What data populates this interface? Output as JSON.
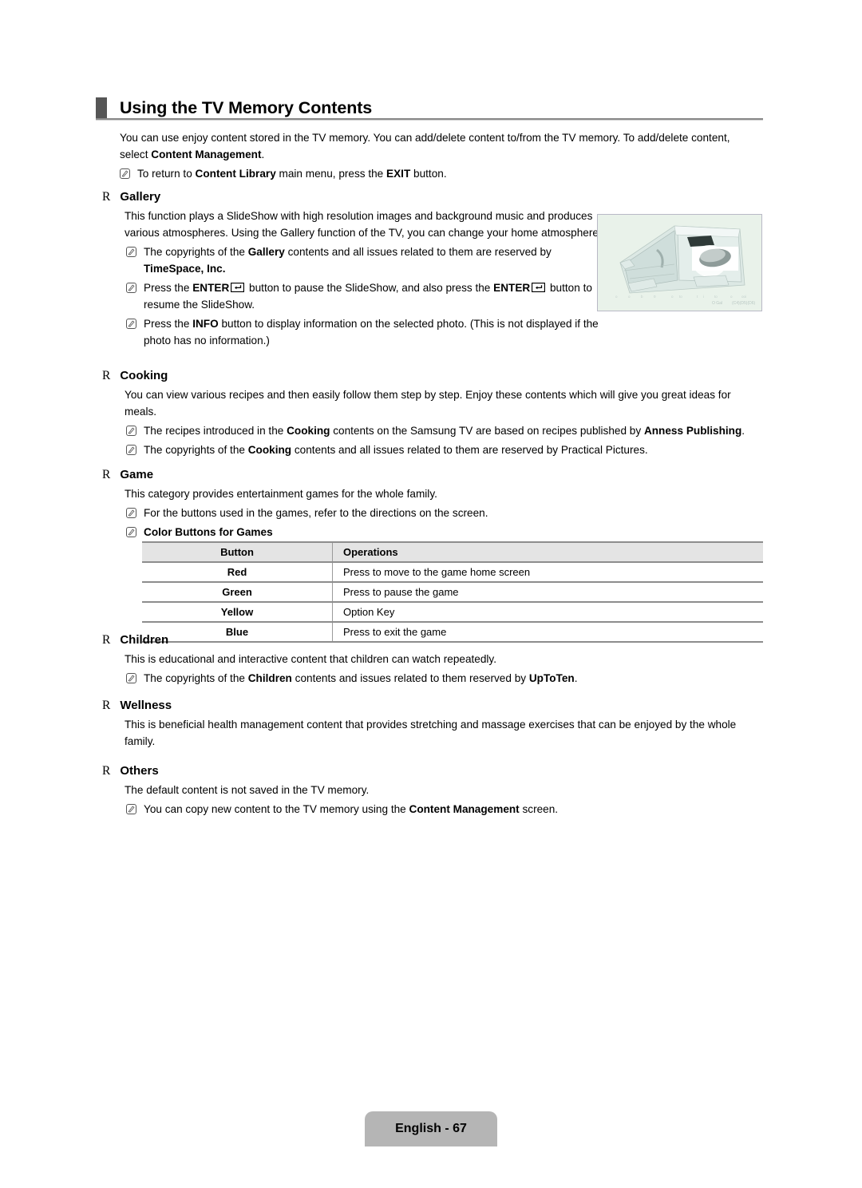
{
  "page": {
    "title": "Using the TV Memory Contents",
    "footer_label": "English - 67",
    "section_marker": "R",
    "note_icon_name": "note-pencil-icon",
    "accent_marker_color": "#565656",
    "footer_bg_color": "#b5b5b5",
    "table_header_bg_color": "#e4e4e4"
  },
  "intro": {
    "paragraph_part1": "You can use enjoy content stored in the TV memory. You can add/delete content to/from the TV memory. To add/delete content, select ",
    "paragraph_bold": "Content Management",
    "paragraph_part2": ".",
    "note1_part1": "To return to ",
    "note1_bold1": "Content Library",
    "note1_part2": " main menu, press the ",
    "note1_bold2": "EXIT",
    "note1_part3": " button."
  },
  "sections": {
    "gallery": {
      "heading": "Gallery",
      "body": "This function plays a SlideShow with high resolution images and background music and produces various atmospheres. Using the Gallery function of the TV, you can change your home atmosphere.",
      "note1_part1": "The copyrights of the ",
      "note1_bold1": "Gallery",
      "note1_part2": " contents and all issues related to them are reserved by ",
      "note1_bold2": "TimeSpace, Inc.",
      "note2_part1": "Press the ",
      "note2_bold1": "ENTER",
      "note2_part2": " button to pause the SlideShow, and also press the ",
      "note2_bold2": "ENTER",
      "note2_part3": " button to resume the SlideShow.",
      "note3_part1": "Press the ",
      "note3_bold1": "INFO",
      "note3_part2": " button to display information on the selected photo. (This is not displayed if the photo has no information.)"
    },
    "cooking": {
      "heading": "Cooking",
      "body": "You can view various recipes and then easily follow them step by step. Enjoy these contents which will give you great ideas for meals.",
      "note1_part1": "The recipes introduced in the ",
      "note1_bold1": "Cooking",
      "note1_part2": " contents on the Samsung TV are based on recipes published by ",
      "note1_bold2": "Anness Publishing",
      "note1_part3": ".",
      "note2_part1": "The copyrights of the ",
      "note2_bold1": "Cooking",
      "note2_part2": " contents and all issues related to them are reserved by Practical Pictures."
    },
    "game": {
      "heading": "Game",
      "body": "This category provides entertainment games for the whole family.",
      "note1": "For the buttons used in the games, refer to the directions on the screen.",
      "note2": "Color Buttons for Games"
    },
    "children": {
      "heading": "Children",
      "body": "This is educational and interactive content that children can watch repeatedly.",
      "note1_part1": "The copyrights of the ",
      "note1_bold1": "Children",
      "note1_part2": " contents and issues related to them reserved by ",
      "note1_bold2": "UpToTen",
      "note1_part3": "."
    },
    "wellness": {
      "heading": "Wellness",
      "body": "This is beneficial health management content that provides stretching and massage exercises that can be enjoyed by the whole family."
    },
    "others": {
      "heading": "Others",
      "body": "The default content is not saved in the TV memory.",
      "note1_part1": "You can copy new content to the TV memory using the ",
      "note1_bold1": "Content Management",
      "note1_part2": " screen."
    }
  },
  "color_table": {
    "headers": [
      "Button",
      "Operations"
    ],
    "rows": [
      {
        "button": "Red",
        "operation": "Press to move to the game home screen"
      },
      {
        "button": "Green",
        "operation": "Press to pause the game"
      },
      {
        "button": "Yellow",
        "operation": "Option Key"
      },
      {
        "button": "Blue",
        "operation": "Press to exit the game"
      }
    ]
  }
}
